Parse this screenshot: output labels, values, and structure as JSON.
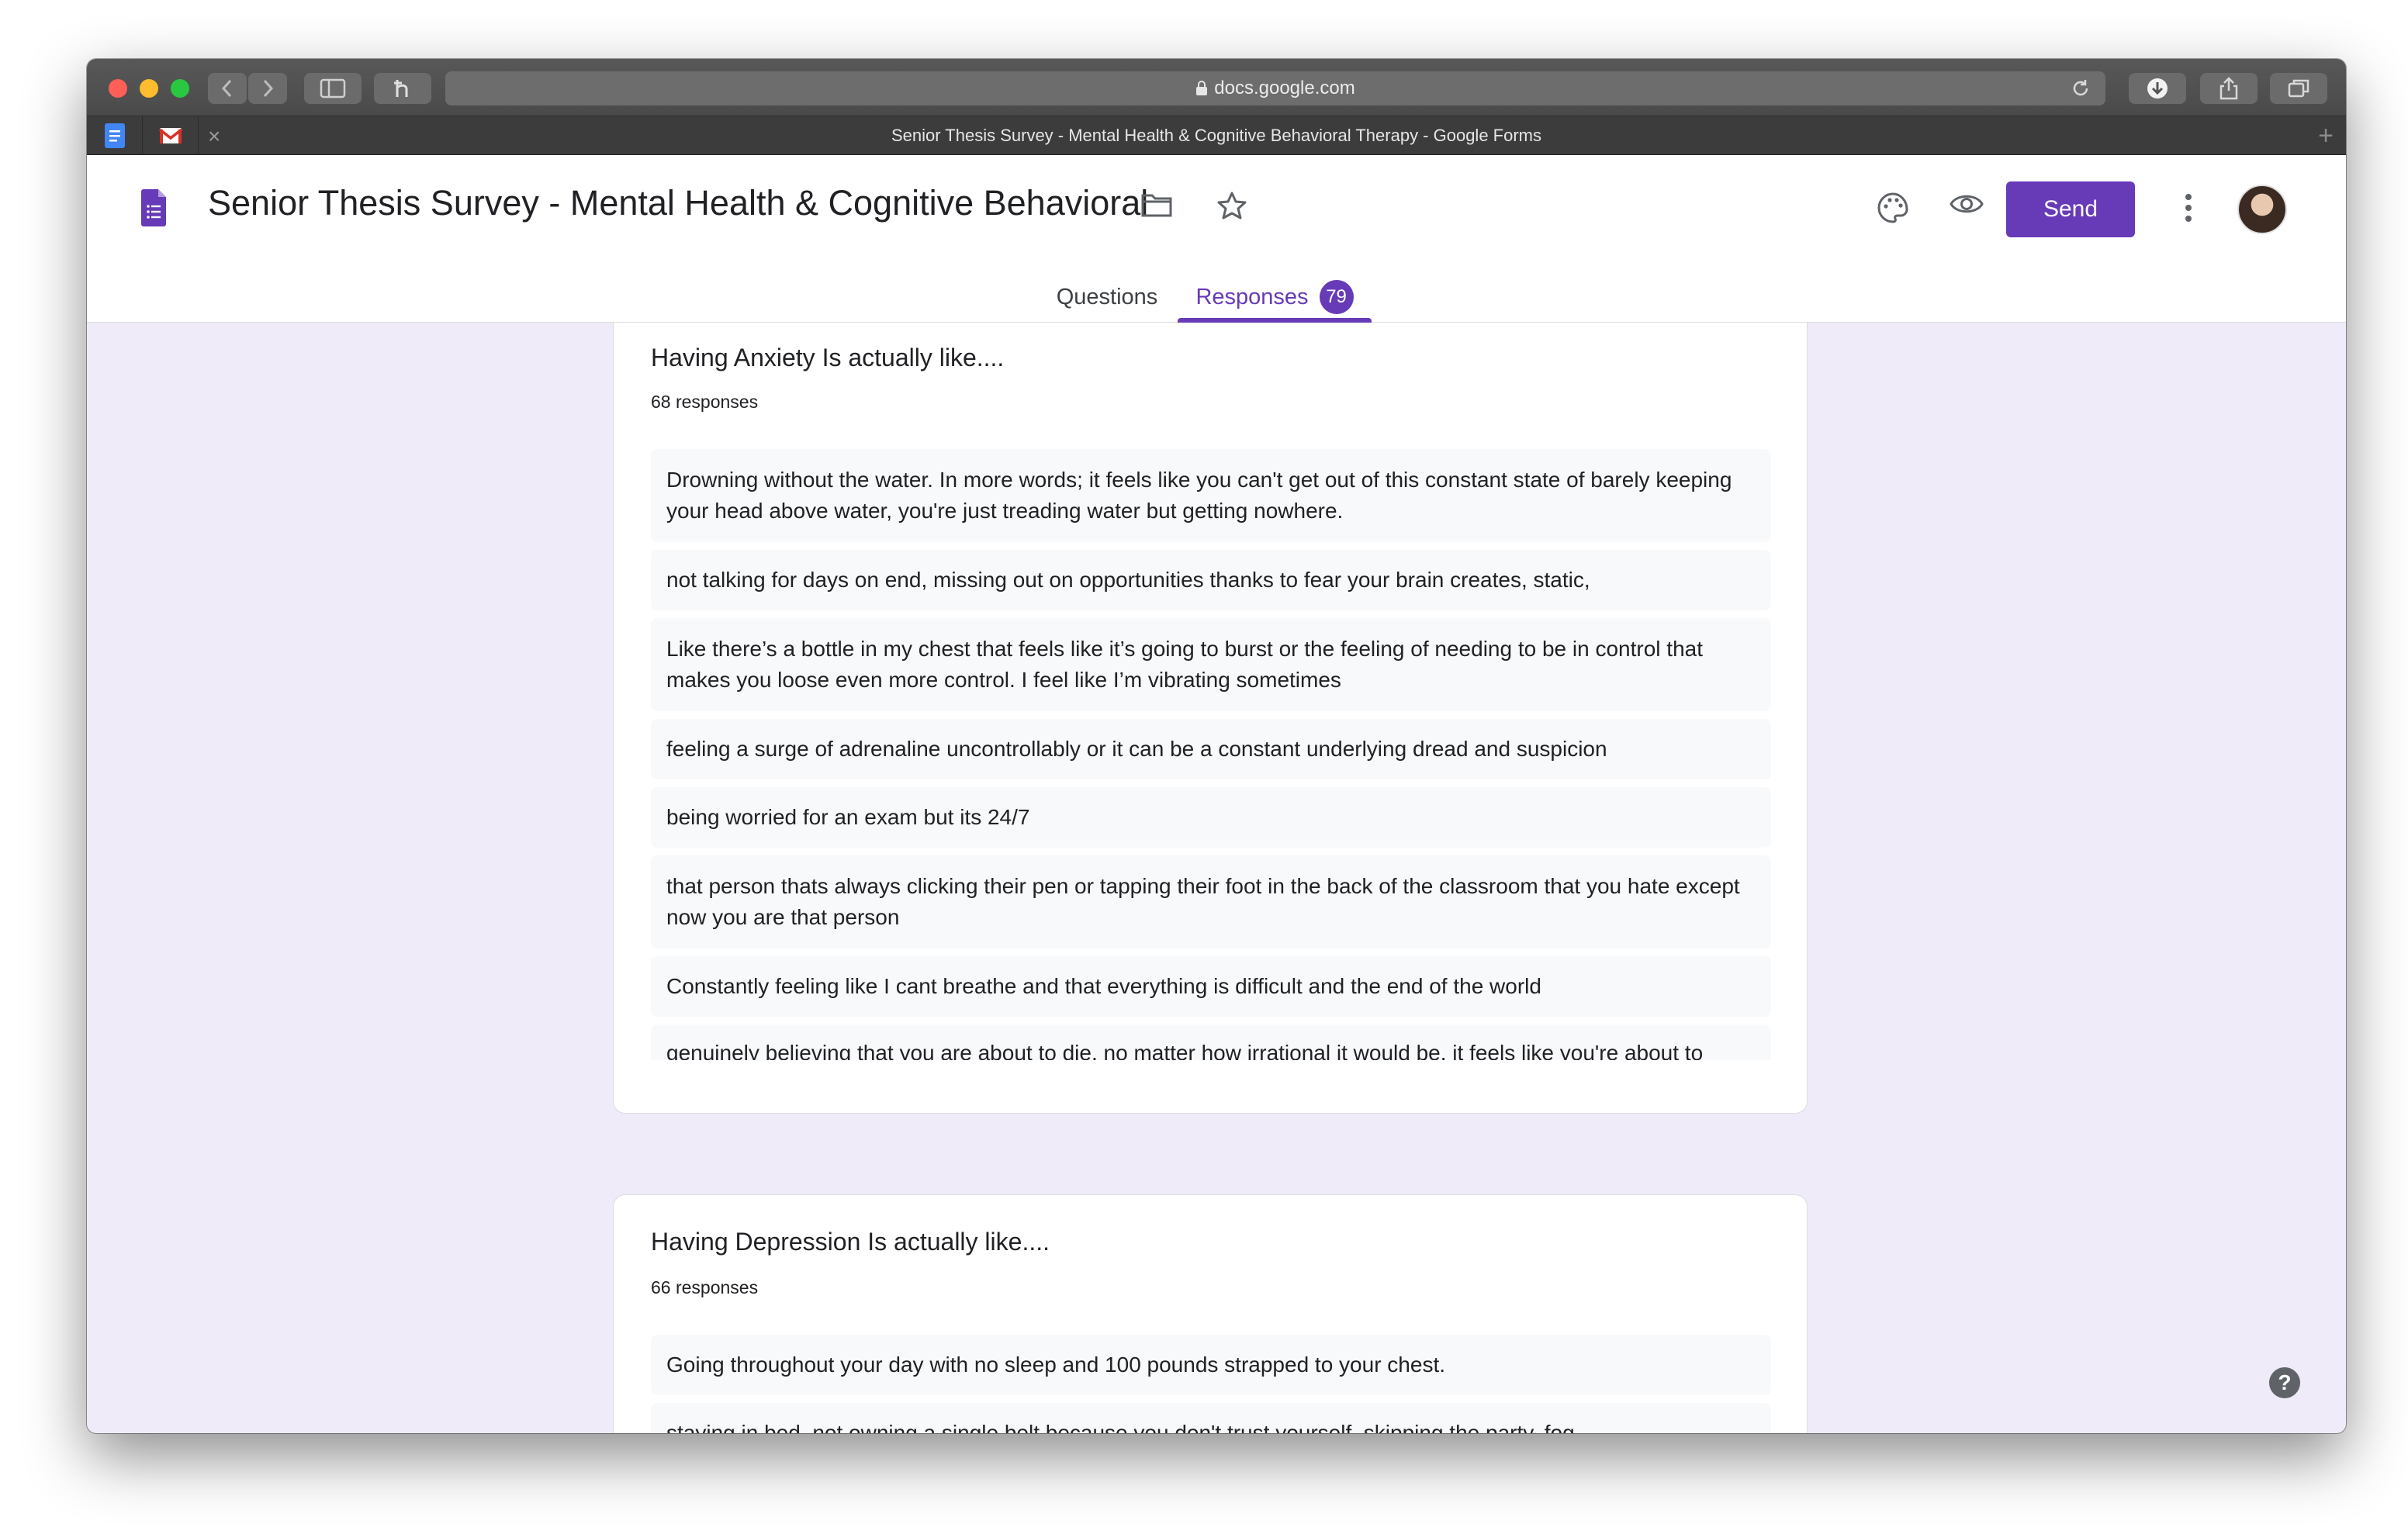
{
  "browser": {
    "url": "docs.google.com",
    "tab_title": "Senior Thesis Survey - Mental Health & Cognitive Behavioral Therapy - Google Forms",
    "tab_close": "×",
    "new_tab": "+"
  },
  "header": {
    "title": "Senior Thesis Survey - Mental Health & Cognitive Behavioral",
    "send_label": "Send"
  },
  "tabs": {
    "questions": "Questions",
    "responses": "Responses",
    "response_count": "79"
  },
  "questions": [
    {
      "title": "Having Anxiety Is actually like....",
      "count": "68 responses",
      "responses": [
        "Drowning without the water. In more words; it feels like you can't get out of this constant state of barely keeping your head above water, you're just treading water but getting nowhere.",
        "not talking for days on end, missing out on opportunities thanks to fear your brain creates, static,",
        "Like there’s a bottle in my chest that feels like it’s going to burst or the feeling of needing to be in control that makes you loose even more control. I feel like I’m vibrating sometimes",
        "feeling a surge of adrenaline uncontrollably or it can be a constant underlying dread and suspicion",
        "being worried for an exam but its 24/7",
        "that person thats always clicking their pen or tapping their foot in the back of the classroom that you hate except now you are that person",
        "Constantly feeling like I cant breathe and that everything is difficult and the end of the world",
        "genuinely believing that you are about to die, no matter how irrational it would be. it feels like you're about to"
      ]
    },
    {
      "title": "Having Depression Is actually like....",
      "count": "66 responses",
      "responses": [
        "Going throughout your day with no sleep and 100 pounds strapped to your chest.",
        "staying in bed, not owning a single belt because you don't trust yourself, skipping the party, fog"
      ]
    }
  ],
  "help_label": "?",
  "colors": {
    "accent": "#673ab7",
    "background": "#f0ebf8",
    "response_bg": "#f8f9fa"
  }
}
